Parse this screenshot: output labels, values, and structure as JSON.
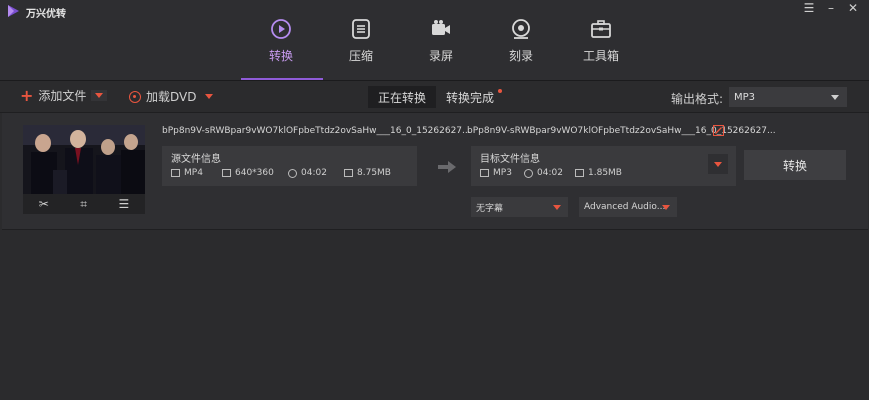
{
  "app": {
    "title": "万兴优转"
  },
  "window": {
    "menu_glyph": "☰",
    "minimize_glyph": "–",
    "close_glyph": "✕"
  },
  "nav": [
    {
      "label": "转换",
      "icon": "convert-icon",
      "active": true
    },
    {
      "label": "压缩",
      "icon": "compress-icon"
    },
    {
      "label": "录屏",
      "icon": "camera-icon"
    },
    {
      "label": "刻录",
      "icon": "disc-icon"
    },
    {
      "label": "工具箱",
      "icon": "toolbox-icon"
    }
  ],
  "toolbar": {
    "add_file": "添加文件",
    "load_dvd": "加载DVD",
    "tab_converting": "正在转换",
    "tab_done": "转换完成",
    "output_label": "输出格式:",
    "output_value": "MP3"
  },
  "file": {
    "source_name": "bPp8n9V-sRWBpar9vWO7klOFpbeTtdz2ovSaHw___16_0_15262627...",
    "target_name": "bPp8n9V-sRWBpar9vWO7klOFpbeTtdz2ovSaHw___16_0_15262627...",
    "source": {
      "title": "源文件信息",
      "format": "MP4",
      "resolution": "640*360",
      "duration": "04:02",
      "size": "8.75MB"
    },
    "target": {
      "title": "目标文件信息",
      "format": "MP3",
      "duration": "04:02",
      "size": "1.85MB"
    },
    "subtitle": "无字幕",
    "audio": "Advanced Audio...",
    "convert_label": "转换"
  },
  "colors": {
    "accent": "#8f5bd8",
    "orange": "#e8553f",
    "bg": "#2b2b2d"
  }
}
